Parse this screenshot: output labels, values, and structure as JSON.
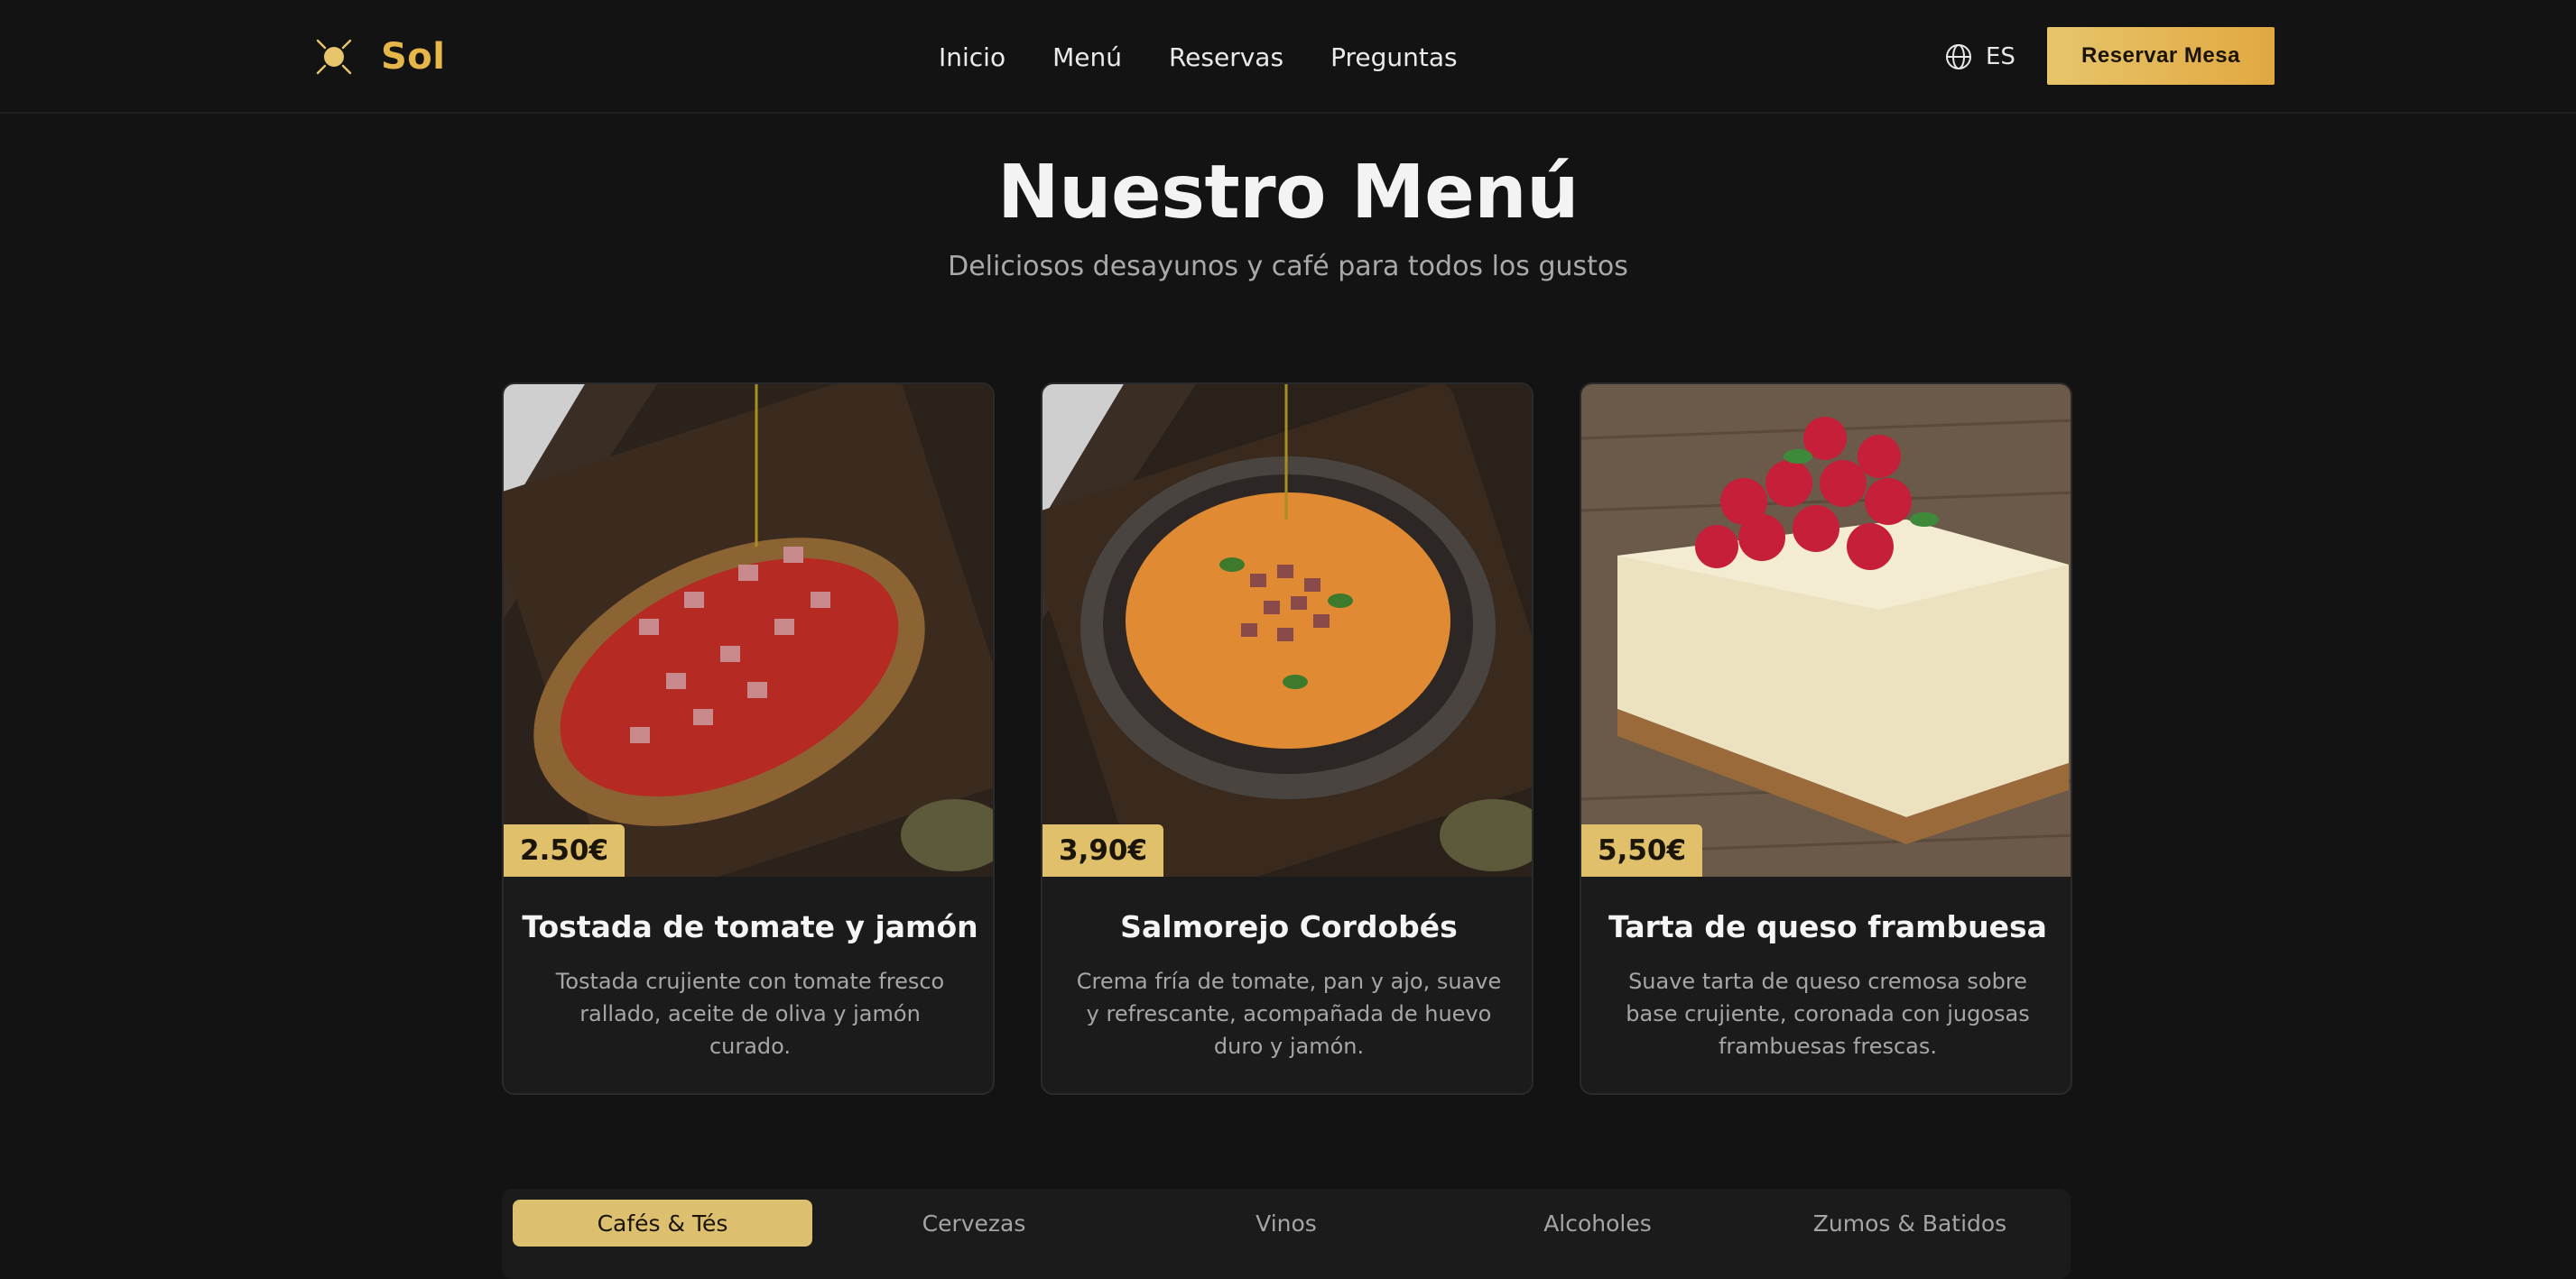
{
  "header": {
    "brand": "Sol",
    "nav": [
      "Inicio",
      "Menú",
      "Reservas",
      "Preguntas"
    ],
    "language": "ES",
    "cta_label": "Reservar Mesa"
  },
  "hero": {
    "title": "Nuestro Menú",
    "subtitle": "Deliciosos desayunos y café para todos los gustos"
  },
  "menu_items": [
    {
      "price": "2.50€",
      "name": "Tostada de tomate y jamón",
      "description": "Tostada crujiente con tomate fresco rallado, aceite de oliva y jamón curado."
    },
    {
      "price": "3,90€",
      "name": "Salmorejo Cordobés",
      "description": "Crema fría de tomate, pan y ajo, suave y refrescante, acompañada de huevo duro y jamón."
    },
    {
      "price": "5,50€",
      "name": "Tarta de queso frambuesa",
      "description": "Suave tarta de queso cremosa sobre base crujiente, coronada con jugosas frambuesas frescas."
    }
  ],
  "tabs": {
    "items": [
      "Cafés & Tés",
      "Cervezas",
      "Vinos",
      "Alcoholes",
      "Zumos & Batidos"
    ],
    "active": "Cafés & Tés"
  },
  "colors": {
    "accent": "#e6b649",
    "background": "#131313",
    "card": "#1b1b1b"
  }
}
